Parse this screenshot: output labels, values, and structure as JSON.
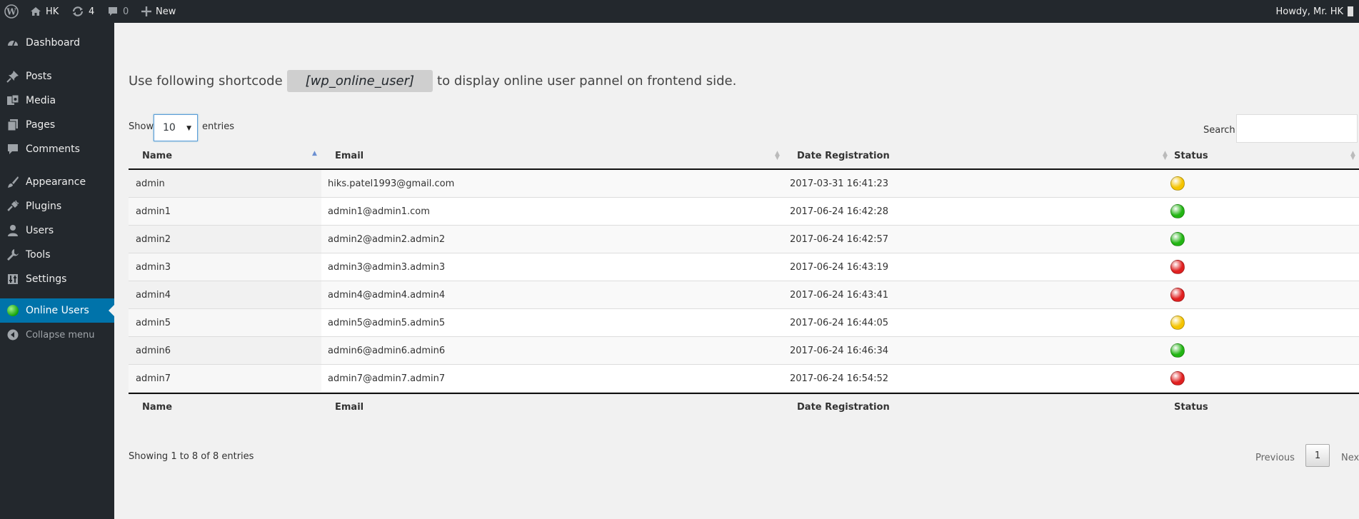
{
  "admin_bar": {
    "site_name": "HK",
    "updates_count": "4",
    "comments_count": "0",
    "new_label": "New",
    "greeting": "Howdy, Mr. HK"
  },
  "sidebar": {
    "items": [
      {
        "label": "Dashboard",
        "icon": "dashboard-icon"
      },
      {
        "label": "Posts",
        "icon": "pin-icon"
      },
      {
        "label": "Media",
        "icon": "media-icon"
      },
      {
        "label": "Pages",
        "icon": "pages-icon"
      },
      {
        "label": "Comments",
        "icon": "comment-icon"
      },
      {
        "label": "Appearance",
        "icon": "paintbrush-icon"
      },
      {
        "label": "Plugins",
        "icon": "plug-icon"
      },
      {
        "label": "Users",
        "icon": "user-icon"
      },
      {
        "label": "Tools",
        "icon": "wrench-icon"
      },
      {
        "label": "Settings",
        "icon": "settings-icon"
      },
      {
        "label": "Online Users",
        "icon": "green-dot-icon",
        "current": true
      }
    ],
    "collapse_label": "Collapse menu"
  },
  "main": {
    "shortcode_prefix": "Use following shortcode",
    "shortcode": "[wp_online_user]",
    "shortcode_suffix": "to display online user pannel on frontend side.",
    "show_label": "Show",
    "page_size": "10",
    "entries_label": "entries",
    "search_label": "Search:",
    "search_value": "",
    "columns": [
      "Name",
      "Email",
      "Date Registration",
      "Status"
    ],
    "rows": [
      {
        "name": "admin",
        "email": "hiks.patel1993@gmail.com",
        "date": "2017-03-31 16:41:23",
        "status": "yellow"
      },
      {
        "name": "admin1",
        "email": "admin1@admin1.com",
        "date": "2017-06-24 16:42:28",
        "status": "green"
      },
      {
        "name": "admin2",
        "email": "admin2@admin2.admin2",
        "date": "2017-06-24 16:42:57",
        "status": "green"
      },
      {
        "name": "admin3",
        "email": "admin3@admin3.admin3",
        "date": "2017-06-24 16:43:19",
        "status": "red"
      },
      {
        "name": "admin4",
        "email": "admin4@admin4.admin4",
        "date": "2017-06-24 16:43:41",
        "status": "red"
      },
      {
        "name": "admin5",
        "email": "admin5@admin5.admin5",
        "date": "2017-06-24 16:44:05",
        "status": "yellow"
      },
      {
        "name": "admin6",
        "email": "admin6@admin6.admin6",
        "date": "2017-06-24 16:46:34",
        "status": "green"
      },
      {
        "name": "admin7",
        "email": "admin7@admin7.admin7",
        "date": "2017-06-24 16:54:52",
        "status": "red"
      }
    ],
    "info_text": "Showing 1 to 8 of 8 entries",
    "pagination": {
      "previous": "Previous",
      "current_page": "1",
      "next": "Next"
    }
  },
  "colors": {
    "status_green": "#22b513",
    "status_yellow": "#f5c400",
    "status_red": "#e02020",
    "accent": "#0073aa"
  }
}
